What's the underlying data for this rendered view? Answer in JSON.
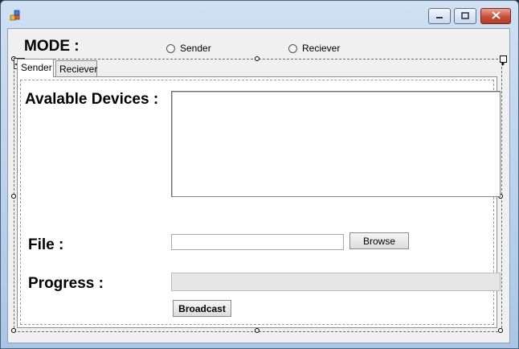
{
  "window": {
    "title": "",
    "icon": "app-icon",
    "controls": [
      "minimize-icon",
      "maximize-icon",
      "close-icon"
    ]
  },
  "mode": {
    "label": "MODE :",
    "options": [
      {
        "label": "Sender",
        "selected": false
      },
      {
        "label": "Reciever",
        "selected": false
      }
    ]
  },
  "tabs": [
    {
      "label": "Sender",
      "active": true
    },
    {
      "label": "Reciever",
      "active": false
    }
  ],
  "sender_page": {
    "devices_label": "Avalable Devices :",
    "devices_items": [],
    "file_label": "File :",
    "file_value": "",
    "browse_label": "Browse",
    "progress_label": "Progress :",
    "progress_percent": 0,
    "broadcast_label": "Broadcast"
  },
  "colors": {
    "window_frame": "#b9d1ea",
    "client_bg": "#f0f0f0",
    "close_button": "#c8503a"
  }
}
